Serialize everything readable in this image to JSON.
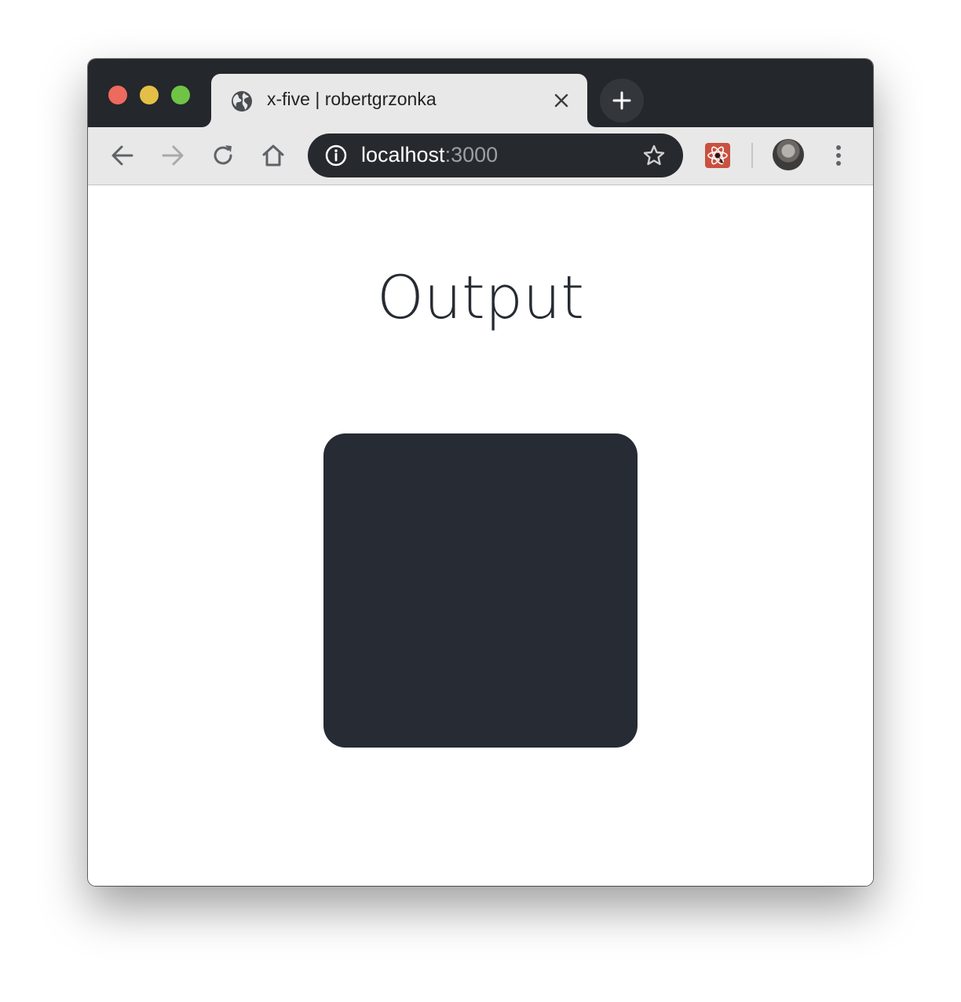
{
  "browser": {
    "tab": {
      "title": "x-five | robertgrzonka",
      "favicon": "globe-icon"
    },
    "address_bar": {
      "host": "localhost",
      "port": ":3000"
    },
    "extensions": [
      "react-devtools-icon"
    ],
    "colors": {
      "chrome_dark": "#24272b",
      "tab_bg": "#e8e8e8",
      "omnibox_bg": "#262a2e"
    }
  },
  "page": {
    "title": "Output",
    "box_color": "#262b34"
  }
}
